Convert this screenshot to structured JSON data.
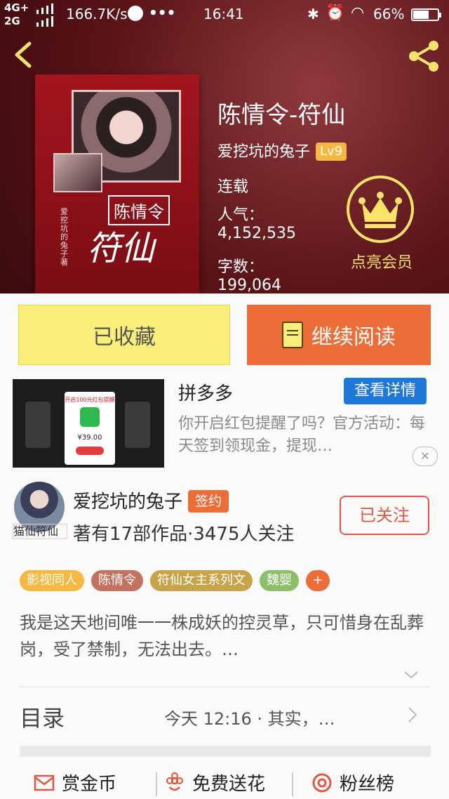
{
  "status_bar": {
    "network_top": "4G+",
    "network_bottom": "2G",
    "speed": "166.7K/s",
    "more": "•••",
    "time": "16:41",
    "battery": "66%"
  },
  "book": {
    "title": "陈情令-符仙",
    "author": "爱挖坑的兔子",
    "author_level": "Lv9",
    "status": "连载",
    "popularity_label": "人气：",
    "popularity": "4,152,535",
    "word_count_label": "字数：",
    "word_count": "199,064",
    "cover_title_small": "陈情令",
    "cover_title_large": "符仙",
    "cover_author": "爱挖坑的兔子著"
  },
  "vip": {
    "label": "点亮会员"
  },
  "buttons": {
    "favorited": "已收藏",
    "continue_reading": "继续阅读"
  },
  "ad": {
    "title": "拼多多",
    "detail_button": "查看详情",
    "description": "你开启红包提醒了吗？官方活动：每天签到领现金，提现…",
    "image_heading": "开启100元红包提醒",
    "image_price": "¥39.00",
    "close": "✕"
  },
  "author_card": {
    "avatar_label": "猫仙符仙",
    "name": "爱挖坑的兔子",
    "badge": "签约",
    "stats": "著有17部作品·3475人关注",
    "follow_button": "已关注"
  },
  "tags": [
    {
      "label": "影视同人",
      "color": "#f5b941"
    },
    {
      "label": "陈情令",
      "color": "#c4725f"
    },
    {
      "label": "符仙女主系列文",
      "color": "#c7a34a"
    },
    {
      "label": "魏婴",
      "color": "#8dbf6a"
    },
    {
      "label": "+",
      "color": "#ec6d38"
    }
  ],
  "intro": {
    "text": "我是这天地间唯一一株成妖的控灵草，只可惜身在乱葬岗，受了禁制，无法出去。…"
  },
  "toc": {
    "label": "目录",
    "latest": "今天 12:16 · 其实，…"
  },
  "actions": {
    "reward": "赏金币",
    "flowers": "免费送花",
    "fans": "粉丝榜"
  },
  "colors": {
    "accent_orange": "#ec6d38",
    "accent_yellow": "#f9ef7a",
    "header_red": "#5a1317",
    "link_blue": "#1e78d7"
  }
}
